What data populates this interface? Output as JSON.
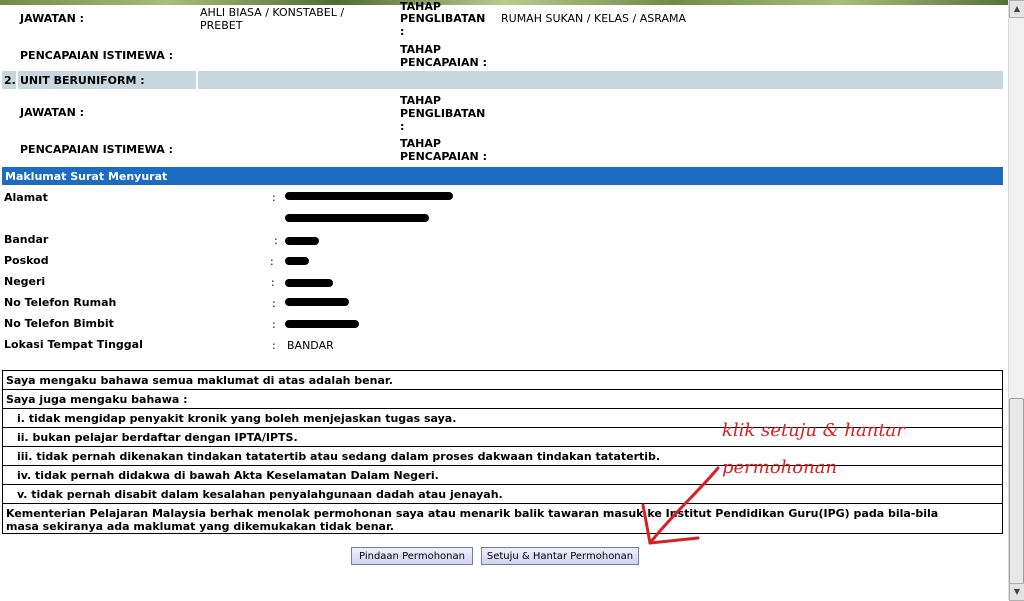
{
  "sec1": {
    "jawatan_label": "JAWATAN :",
    "jawatan_value_line1": "AHLI BIASA / KONSTABEL /",
    "jawatan_value_line2": "PREBET",
    "tahap_penglibatan_line1": "TAHAP",
    "tahap_penglibatan_line2": "PENGLIBATAN",
    "tahap_penglibatan_line3": ":",
    "tahap_penglibatan_value": "RUMAH SUKAN / KELAS / ASRAMA",
    "pencapaian_label": "PENCAPAIAN ISTIMEWA :",
    "tahap_pencapaian_line1": "TAHAP",
    "tahap_pencapaian_line2": "PENCAPAIAN :"
  },
  "sec2": {
    "number": "2.",
    "title": "UNIT BERUNIFORM :",
    "jawatan_label": "JAWATAN :",
    "tahap_penglibatan_line1": "TAHAP",
    "tahap_penglibatan_line2": "PENGLIBATAN",
    "tahap_penglibatan_line3": ":",
    "pencapaian_label": "PENCAPAIAN ISTIMEWA :",
    "tahap_pencapaian_line1": "TAHAP",
    "tahap_pencapaian_line2": "PENCAPAIAN :"
  },
  "surat": {
    "header": "Maklumat Surat Menyurat",
    "colon": ":",
    "alamat_label": "Alamat",
    "bandar_label": "Bandar",
    "poskod_label": "Poskod",
    "negeri_label": "Negeri",
    "tel_rumah_label": "No Telefon Rumah",
    "tel_bimbit_label": "No Telefon Bimbit",
    "lokasi_label": "Lokasi Tempat Tinggal",
    "lokasi_value": "BANDAR"
  },
  "declaration": {
    "line1": "Saya mengaku bahawa semua maklumat di atas adalah benar.",
    "line2": "Saya juga mengaku bahawa :",
    "items": [
      "i.   tidak mengidap penyakit kronik yang boleh menjejaskan tugas saya.",
      "ii.  bukan pelajar berdaftar dengan IPTA/IPTS.",
      "iii. tidak pernah dikenakan tindakan tatatertib atau sedang dalam proses dakwaan tindakan tatatertib.",
      "iv. tidak pernah didakwa di bawah Akta Keselamatan Dalam Negeri.",
      "v.  tidak pernah disabit dalam kesalahan penyalahgunaan dadah atau jenayah."
    ],
    "footer_line1": "Kementerian Pelajaran Malaysia berhak menolak permohonan saya atau menarik balik tawaran masuk ke Institut Pendidikan Guru(IPG) pada bila-bila",
    "footer_line2": "masa sekiranya ada maklumat yang dikemukakan tidak benar."
  },
  "buttons": {
    "pindaan": "Pindaan Permohonan",
    "setuju": "Setuju & Hantar Permohonan"
  },
  "annotation": {
    "line1": "klik setuju & hantar",
    "line2": "permohonan",
    "color": "#d62222"
  }
}
